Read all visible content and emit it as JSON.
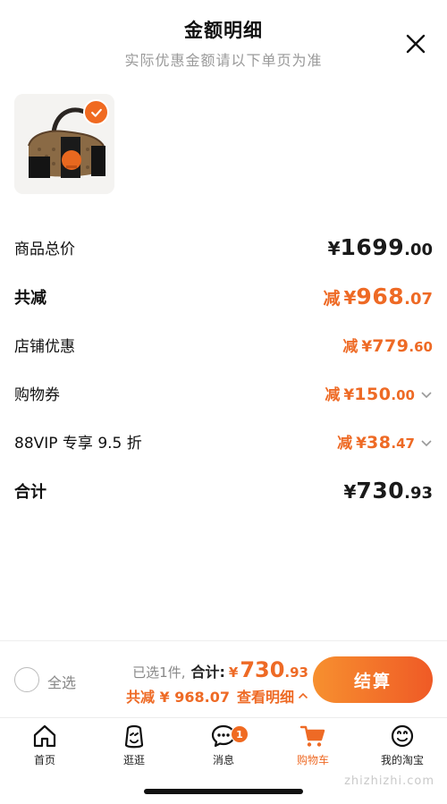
{
  "sheet": {
    "title": "金额明细",
    "subtitle": "实际优惠金额请以下单页为准"
  },
  "product": {
    "image": "handbag-product-image",
    "selected": true
  },
  "rows": {
    "total": {
      "label": "商品总价",
      "prefix": "",
      "symbol": "¥",
      "integer": "1699",
      "decimal": ".00"
    },
    "reduce": {
      "label": "共减",
      "prefix": "减",
      "symbol": "¥",
      "integer": "968",
      "decimal": ".07"
    },
    "shop": {
      "label": "店铺优惠",
      "prefix": "减",
      "symbol": "¥",
      "integer": "779",
      "decimal": ".60"
    },
    "coupon": {
      "label": "购物券",
      "prefix": "减",
      "symbol": "¥",
      "integer": "150",
      "decimal": ".00"
    },
    "vip": {
      "label": "88VIP 专享 9.5 折",
      "prefix": "减",
      "symbol": "¥",
      "integer": "38",
      "decimal": ".47"
    },
    "subtotal": {
      "label": "合计",
      "prefix": "",
      "symbol": "¥",
      "integer": "730",
      "decimal": ".93"
    }
  },
  "bottom": {
    "select_all": "全选",
    "chosen": "已选1件,",
    "total_label": "合计:",
    "symbol": "¥",
    "integer": "730",
    "decimal": ".93",
    "reduce_text": "共减 ¥ 968.07",
    "detail_link": "查看明细",
    "checkout": "结算"
  },
  "tabs": [
    {
      "label": "首页",
      "icon": "home-icon"
    },
    {
      "label": "逛逛",
      "icon": "browse-icon"
    },
    {
      "label": "消息",
      "icon": "message-icon",
      "badge": "1"
    },
    {
      "label": "购物车",
      "icon": "cart-icon"
    },
    {
      "label": "我的淘宝",
      "icon": "profile-icon"
    }
  ],
  "watermark": "zhizhizhi.com",
  "colors": {
    "accent": "#ee6a25",
    "text": "#1a1a1a",
    "muted": "#9a9a9a"
  }
}
